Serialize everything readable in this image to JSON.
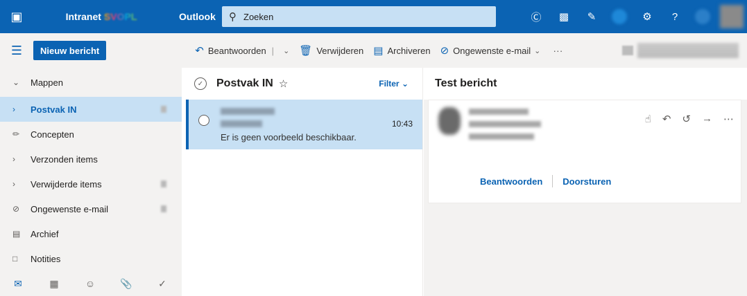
{
  "topbar": {
    "brand": "Intranet",
    "brand_mark": "SVOPL",
    "app_name": "Outlook",
    "search_placeholder": "Zoeken",
    "waffle_glyph": "⋮⋮",
    "icons": [
      "skype-icon",
      "office-icon",
      "tasks-icon",
      "notification-icon",
      "settings-icon",
      "help-icon",
      "profile-icon"
    ],
    "help_glyph": "?"
  },
  "commandbar": {
    "new_message": "Nieuw bericht",
    "reply": "Beantwoorden",
    "delete": "Verwijderen",
    "archive": "Archiveren",
    "junk": "Ongewenste e-mail",
    "more": "···"
  },
  "folders": {
    "header": "Mappen",
    "items": [
      {
        "label": "Postvak IN",
        "icon": "chevron-right-icon",
        "selected": true
      },
      {
        "label": "Concepten",
        "icon": "pencil-icon"
      },
      {
        "label": "Verzonden items",
        "icon": "chevron-right-icon"
      },
      {
        "label": "Verwijderde items",
        "icon": "chevron-right-icon"
      },
      {
        "label": "Ongewenste e-mail",
        "icon": "blocked-icon"
      },
      {
        "label": "Archief",
        "icon": "archive-icon"
      },
      {
        "label": "Notities",
        "icon": "note-icon"
      }
    ]
  },
  "messagelist": {
    "title": "Postvak IN",
    "filter": "Filter",
    "messages": [
      {
        "time": "10:43",
        "preview": "Er is geen voorbeeld beschikbaar."
      }
    ]
  },
  "reading": {
    "subject": "Test bericht",
    "reply": "Beantwoorden",
    "forward": "Doorsturen"
  },
  "colors": {
    "accent": "#0b63b3",
    "selected": "#c7e0f4",
    "pane": "#f3f2f1"
  }
}
